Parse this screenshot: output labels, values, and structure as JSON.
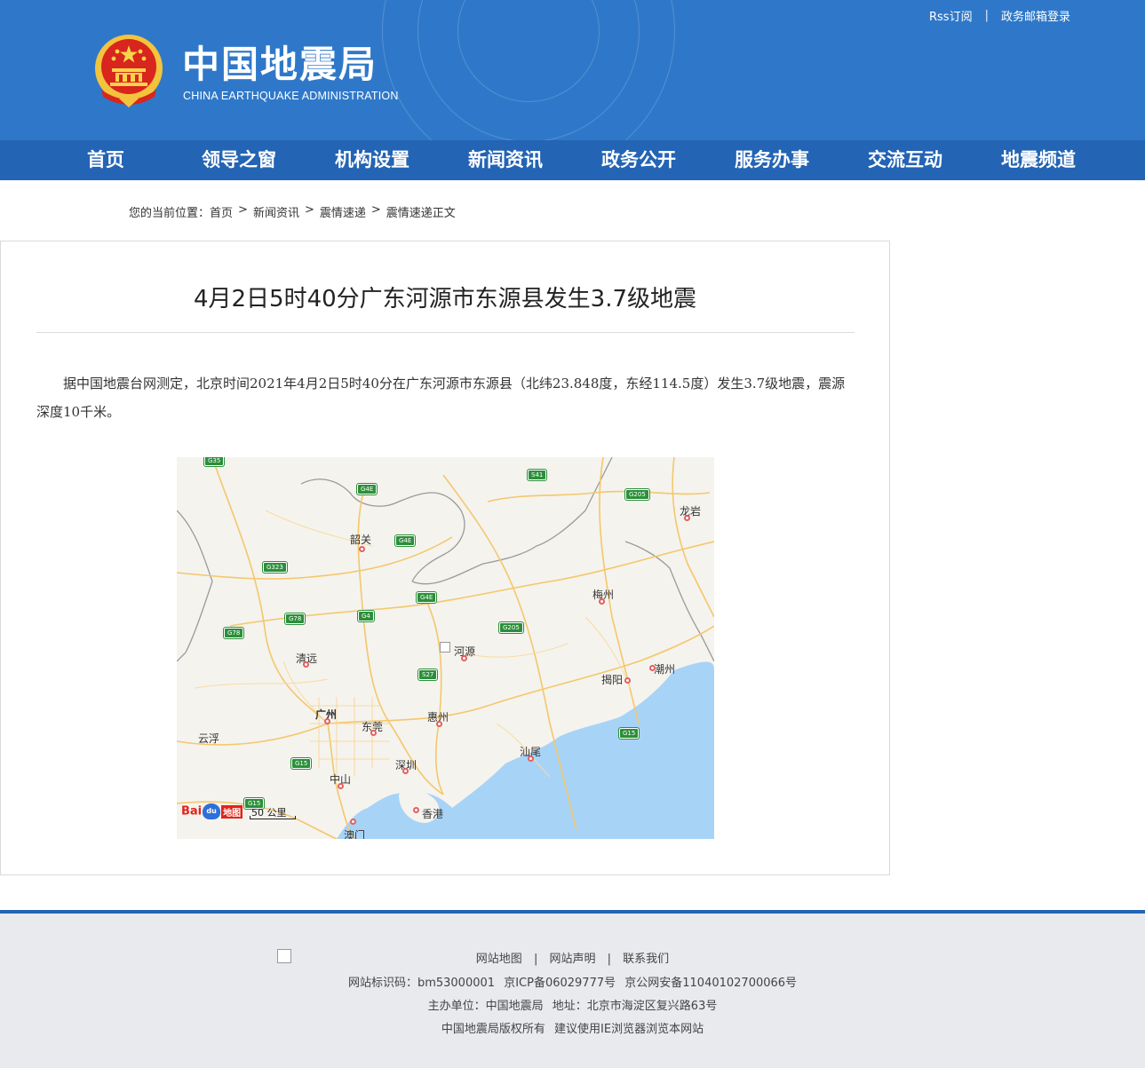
{
  "header": {
    "title": "中国地震局",
    "subtitle": "CHINA EARTHQUAKE ADMINISTRATION",
    "top_links": [
      "Rss订阅",
      "政务邮箱登录"
    ],
    "top_sep": "|"
  },
  "nav": [
    "首页",
    "领导之窗",
    "机构设置",
    "新闻资讯",
    "政务公开",
    "服务办事",
    "交流互动",
    "地震频道"
  ],
  "breadcrumb": {
    "prefix": "您的当前位置：",
    "items": [
      "首页",
      "新闻资讯",
      "震情速递",
      "震情速递正文"
    ],
    "sep": ">"
  },
  "article": {
    "title": "4月2日5时40分广东河源市东源县发生3.7级地震",
    "body": "据中国地震台网测定，北京时间2021年4月2日5时40分在广东河源市东源县（北纬23.848度，东经114.5度）发生3.7级地震，震源深度10千米。"
  },
  "map": {
    "cities": [
      "韶关",
      "龙岩",
      "梅州",
      "清远",
      "河源",
      "潮州",
      "揭阳",
      "广州",
      "惠州",
      "东莞",
      "云浮",
      "汕尾",
      "深圳",
      "中山",
      "香港",
      "澳门"
    ],
    "shields": [
      "G35",
      "G4E",
      "S41",
      "G205",
      "G4E",
      "G323",
      "G4E",
      "G78",
      "G4",
      "G78",
      "G205",
      "S27",
      "G15",
      "G15",
      "G15"
    ],
    "logo": {
      "bai": "Bai",
      "du": "du",
      "ditu": "地图"
    },
    "scale": "50 公里"
  },
  "footer": {
    "links": [
      "网站地图",
      "网站声明",
      "联系我们"
    ],
    "sep": "|",
    "site_id_label": "网站标识码：bm53000001",
    "icp": "京ICP备06029777号",
    "police": "京公网安备11040102700066号",
    "sponsor": "主办单位：中国地震局",
    "address": "地址：北京市海淀区复兴路63号",
    "copyright": "中国地震局版权所有",
    "browser": "建议使用IE浏览器浏览本网站"
  }
}
